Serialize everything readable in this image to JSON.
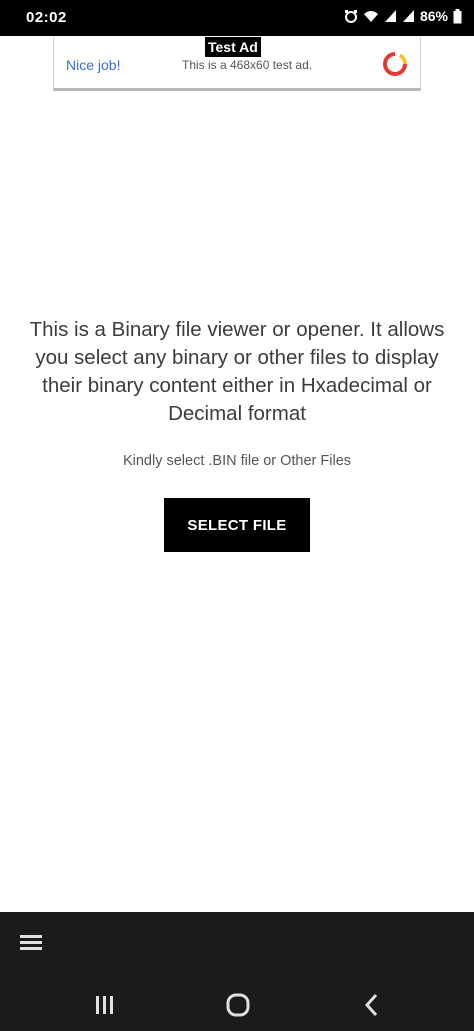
{
  "status_bar": {
    "time": "02:02",
    "battery": "86%",
    "icons": [
      "alarm-icon",
      "wifi-icon",
      "signal-icon",
      "battery-icon"
    ]
  },
  "ad": {
    "tag": "Test Ad",
    "left_text": "Nice job!",
    "mid_text": "This is a 468x60 test ad.",
    "logo_icon": "ad-brand-logo-icon"
  },
  "main": {
    "description": "This is a Binary file viewer or opener. It allows you select any binary or other files to display their binary content either in Hxadecimal or Decimal format",
    "hint": "Kindly select .BIN file or Other Files",
    "select_button_label": "SELECT FILE"
  },
  "bottom": {
    "menu_icon": "hamburger-menu-icon",
    "nav_icons": [
      "recents-icon",
      "home-icon",
      "back-icon"
    ]
  },
  "colors": {
    "status_bar_bg": "#000000",
    "button_bg": "#000000",
    "button_text": "#ffffff",
    "ad_link": "#3b6fd6",
    "bottom_bar_bg": "#1b1b1d"
  }
}
